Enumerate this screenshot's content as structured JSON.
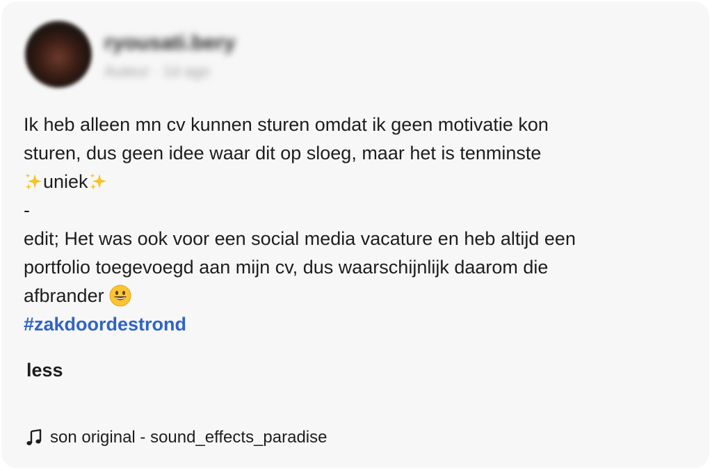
{
  "post": {
    "author_name": "ryousati.bery",
    "author_meta": "Auteur · 1d ago",
    "caption_lines": [
      "Ik heb alleen mn cv kunnen sturen omdat ik geen motivatie kon",
      "sturen, dus geen idee waar dit op sloeg, maar het is tenminste"
    ],
    "caption_uniek": "uniek",
    "caption_dash": "-",
    "caption_edit_lines": [
      "edit; Het was ook voor een social media vacature en heb altijd een",
      "portfolio toegevoegd aan mijn cv, dus waarschijnlijk daarom die"
    ],
    "caption_last": "afbrander",
    "hashtag": "#zakdoordestrond",
    "less_label": "less",
    "sound_label": "son original - sound_effects_paradise"
  },
  "icons": {
    "sparkle": "sparkles-emoji",
    "smile": "grinning-face-emoji",
    "music": "music-note-icon"
  },
  "colors": {
    "card_background": "#f7f7f7",
    "hashtag": "#2f64c4",
    "text": "#1d1d1d"
  }
}
